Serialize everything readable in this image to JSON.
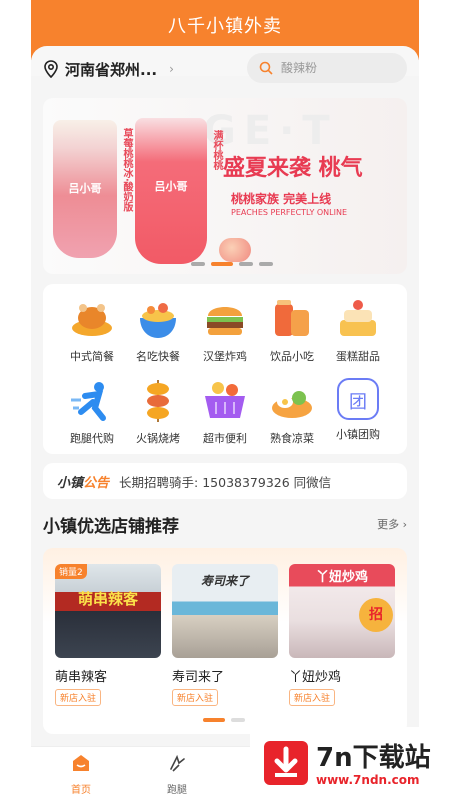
{
  "app": {
    "title": "八千小镇外卖"
  },
  "header": {
    "location": "河南省郑州...",
    "search_placeholder": "酸辣粉"
  },
  "banner": {
    "bg_text": "GE·T",
    "cup_logo_1": "吕小哥",
    "cup_logo_2": "吕小哥",
    "vertical_text_1": "草莓桃桃冰·酸奶版",
    "vertical_text_2": "满杯桃桃",
    "headline": "盛夏来袭 桃气",
    "subline": "桃桃家族 完美上线",
    "english_line": "PEACHES PERFECTLY ONLINE",
    "dot_count": 4,
    "active_dot": 1
  },
  "categories": [
    {
      "label": "中式简餐",
      "icon": "roast-chicken-icon",
      "color": "#f7a23a"
    },
    {
      "label": "名吃快餐",
      "icon": "noodle-bowl-icon",
      "color": "#4aa3f0"
    },
    {
      "label": "汉堡炸鸡",
      "icon": "burger-icon",
      "color": "#f29a3a"
    },
    {
      "label": "饮品小吃",
      "icon": "drink-snack-icon",
      "color": "#f45b3a"
    },
    {
      "label": "蛋糕甜品",
      "icon": "cake-icon",
      "color": "#f6b948"
    },
    {
      "label": "跑腿代购",
      "icon": "runner-icon",
      "color": "#2d8cf0"
    },
    {
      "label": "火锅烧烤",
      "icon": "skewer-icon",
      "color": "#f5a623"
    },
    {
      "label": "超市便利",
      "icon": "basket-icon",
      "color": "#a45cf0"
    },
    {
      "label": "熟食凉菜",
      "icon": "egg-dish-icon",
      "color": "#f6a341"
    },
    {
      "label": "小镇团购",
      "icon": "group-buy-icon",
      "color": "#6b7cf5",
      "glyph": "团"
    }
  ],
  "notice": {
    "brand_a": "小镇",
    "brand_b": "公告",
    "message": "长期招聘骑手: 15038379326 同微信"
  },
  "shops_section": {
    "title": "小镇优选店铺推荐",
    "more": "更多",
    "shops": [
      {
        "name": "萌串辣客",
        "tag": "新店入驻",
        "badge": "销量2",
        "sign": "萌串辣客"
      },
      {
        "name": "寿司来了",
        "tag": "新店入驻",
        "sign": "寿司来了"
      },
      {
        "name": "丫妞炒鸡",
        "tag": "新店入驻",
        "sign": "丫妞炒鸡",
        "promo": "招"
      }
    ]
  },
  "tabbar": {
    "tabs": [
      {
        "label": "首页",
        "active": true
      },
      {
        "label": "跑腿",
        "active": false
      }
    ]
  },
  "watermark": {
    "title": "7n下载站",
    "url": "www.7ndn.com"
  }
}
